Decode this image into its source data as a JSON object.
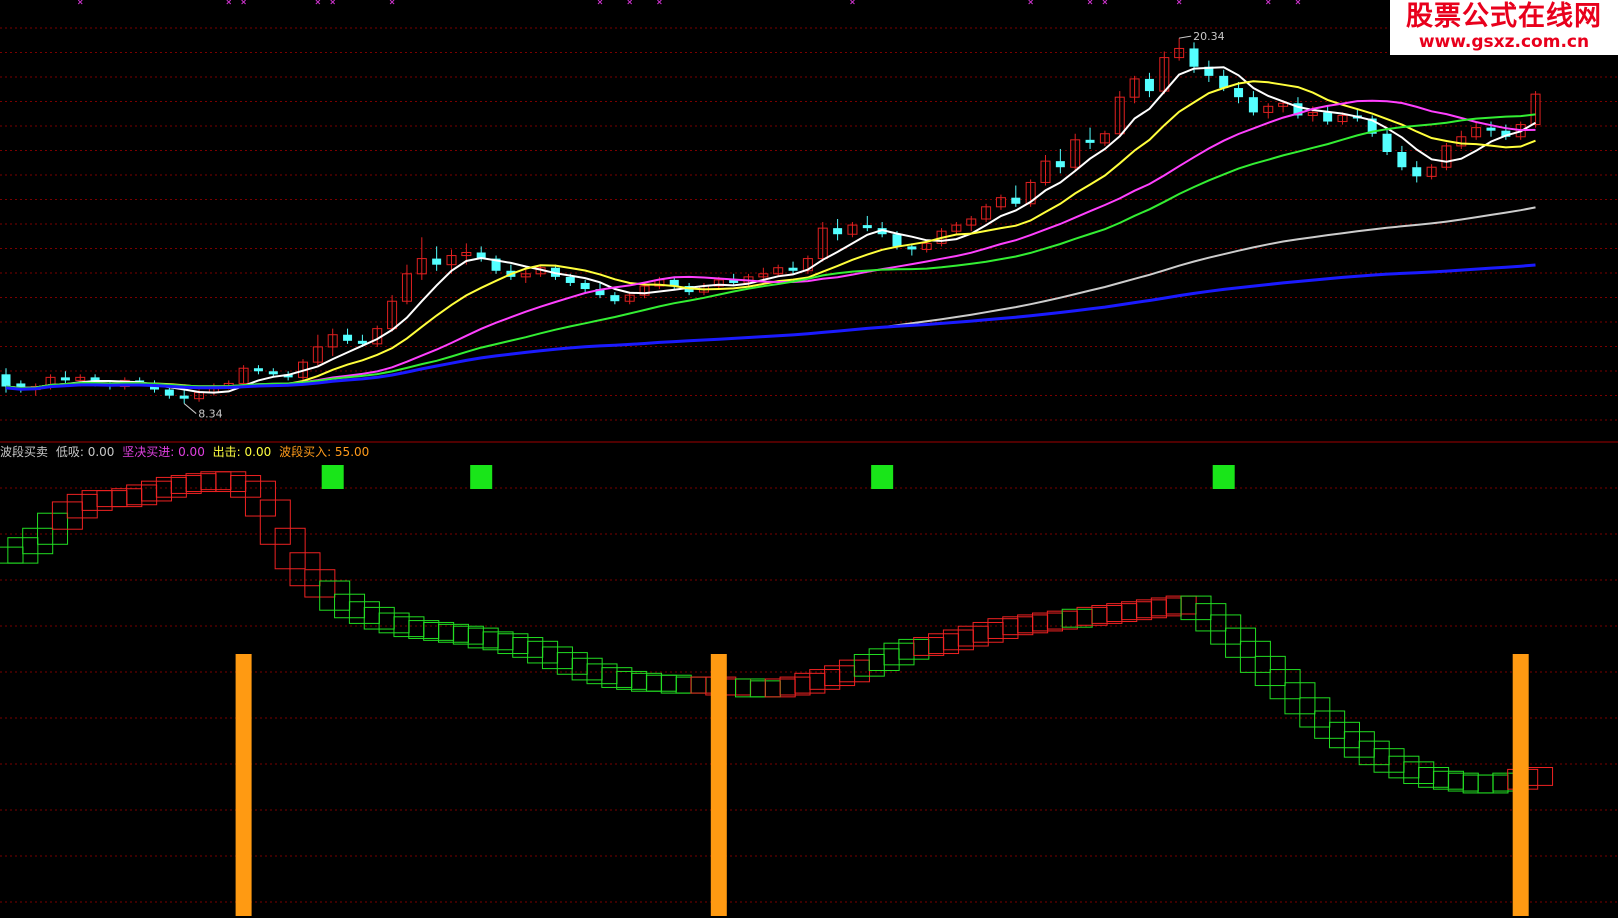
{
  "watermark": {
    "site_name": "股票公式在线网",
    "url": "www.gsxz.com.cn"
  },
  "colors": {
    "background": "#000000",
    "grid": "#7a0000",
    "candle_up": "#e02020",
    "candle_down": "#54ffff",
    "ma1": "#ffffff",
    "ma2": "#ffff3c",
    "ma3": "#ff40ff",
    "ma4": "#33ee33",
    "ma5": "#cccccc",
    "ma6": "#1a1aff",
    "marker": "#cc33cc"
  },
  "indicator_legend": [
    {
      "text": "波段买卖",
      "color": "#c8c8c8"
    },
    {
      "text": "低吸: 0.00",
      "color": "#c8c8c8"
    },
    {
      "text": "坚决买进: 0.00",
      "color": "#e040e0"
    },
    {
      "text": "出击: 0.00",
      "color": "#ffff40"
    },
    {
      "text": "波段买入: 55.00",
      "color": "#ff9a1a"
    }
  ],
  "chart_data": [
    {
      "type": "candlestick",
      "grid": true,
      "price_labels": [
        {
          "text": "20.34",
          "bar": 79,
          "value": 20.34
        },
        {
          "text": "8.34",
          "bar": 12,
          "value": 8.34
        }
      ],
      "candles": [
        [
          9.3,
          9.5,
          8.7,
          8.9
        ],
        [
          9.0,
          9.1,
          8.7,
          8.8
        ],
        [
          8.8,
          9.0,
          8.6,
          8.9
        ],
        [
          8.9,
          9.3,
          8.8,
          9.2
        ],
        [
          9.2,
          9.4,
          9.0,
          9.1
        ],
        [
          9.1,
          9.3,
          8.9,
          9.2
        ],
        [
          9.2,
          9.3,
          8.9,
          9.0
        ],
        [
          9.0,
          9.1,
          8.8,
          8.9
        ],
        [
          8.9,
          9.2,
          8.8,
          9.1
        ],
        [
          9.1,
          9.2,
          8.9,
          9.0
        ],
        [
          9.0,
          9.1,
          8.7,
          8.8
        ],
        [
          8.8,
          8.9,
          8.5,
          8.6
        ],
        [
          8.6,
          8.8,
          8.34,
          8.5
        ],
        [
          8.5,
          8.8,
          8.4,
          8.7
        ],
        [
          8.7,
          9.0,
          8.6,
          8.9
        ],
        [
          8.9,
          9.1,
          8.8,
          9.0
        ],
        [
          9.0,
          9.6,
          8.9,
          9.5
        ],
        [
          9.5,
          9.6,
          9.3,
          9.4
        ],
        [
          9.4,
          9.5,
          9.2,
          9.3
        ],
        [
          9.3,
          9.4,
          9.1,
          9.2
        ],
        [
          9.2,
          9.8,
          9.1,
          9.7
        ],
        [
          9.7,
          10.6,
          9.6,
          10.2
        ],
        [
          10.2,
          10.8,
          9.9,
          10.6
        ],
        [
          10.6,
          10.8,
          10.3,
          10.4
        ],
        [
          10.4,
          10.6,
          10.2,
          10.3
        ],
        [
          10.3,
          10.9,
          10.2,
          10.8
        ],
        [
          10.8,
          11.9,
          10.7,
          11.7
        ],
        [
          11.7,
          12.9,
          11.6,
          12.6
        ],
        [
          12.6,
          13.8,
          12.4,
          13.1
        ],
        [
          13.1,
          13.5,
          12.7,
          12.9
        ],
        [
          12.9,
          13.4,
          12.6,
          13.2
        ],
        [
          13.2,
          13.6,
          12.9,
          13.3
        ],
        [
          13.3,
          13.5,
          13.0,
          13.1
        ],
        [
          13.1,
          13.2,
          12.6,
          12.7
        ],
        [
          12.7,
          12.9,
          12.4,
          12.5
        ],
        [
          12.5,
          12.8,
          12.3,
          12.6
        ],
        [
          12.6,
          12.9,
          12.5,
          12.8
        ],
        [
          12.8,
          12.9,
          12.4,
          12.5
        ],
        [
          12.5,
          12.6,
          12.2,
          12.3
        ],
        [
          12.3,
          12.4,
          12.0,
          12.1
        ],
        [
          12.1,
          12.3,
          11.8,
          11.9
        ],
        [
          11.9,
          12.0,
          11.6,
          11.7
        ],
        [
          11.7,
          12.0,
          11.6,
          11.9
        ],
        [
          11.9,
          12.3,
          11.8,
          12.2
        ],
        [
          12.2,
          12.5,
          12.1,
          12.4
        ],
        [
          12.4,
          12.5,
          12.1,
          12.2
        ],
        [
          12.2,
          12.3,
          11.9,
          12.0
        ],
        [
          12.0,
          12.3,
          11.9,
          12.2
        ],
        [
          12.2,
          12.5,
          12.1,
          12.4
        ],
        [
          12.4,
          12.6,
          12.2,
          12.3
        ],
        [
          12.3,
          12.6,
          12.2,
          12.5
        ],
        [
          12.5,
          12.8,
          12.4,
          12.6
        ],
        [
          12.6,
          12.9,
          12.5,
          12.8
        ],
        [
          12.8,
          13.0,
          12.6,
          12.7
        ],
        [
          12.7,
          13.2,
          12.6,
          13.1
        ],
        [
          13.1,
          14.3,
          13.0,
          14.1
        ],
        [
          14.1,
          14.4,
          13.7,
          13.9
        ],
        [
          13.9,
          14.3,
          13.8,
          14.2
        ],
        [
          14.2,
          14.5,
          14.0,
          14.1
        ],
        [
          14.1,
          14.3,
          13.8,
          13.9
        ],
        [
          13.9,
          14.0,
          13.4,
          13.5
        ],
        [
          13.5,
          13.6,
          13.2,
          13.4
        ],
        [
          13.4,
          13.7,
          13.3,
          13.6
        ],
        [
          13.6,
          14.1,
          13.5,
          14.0
        ],
        [
          14.0,
          14.3,
          13.9,
          14.2
        ],
        [
          14.2,
          14.5,
          14.0,
          14.4
        ],
        [
          14.4,
          14.9,
          14.3,
          14.8
        ],
        [
          14.8,
          15.2,
          14.7,
          15.1
        ],
        [
          15.1,
          15.5,
          14.8,
          14.9
        ],
        [
          14.9,
          15.7,
          14.8,
          15.6
        ],
        [
          15.6,
          16.5,
          15.5,
          16.3
        ],
        [
          16.3,
          16.7,
          15.9,
          16.1
        ],
        [
          16.1,
          17.2,
          16.0,
          17.0
        ],
        [
          17.0,
          17.4,
          16.7,
          16.9
        ],
        [
          16.9,
          17.3,
          16.8,
          17.2
        ],
        [
          17.2,
          18.6,
          17.1,
          18.4
        ],
        [
          18.4,
          19.1,
          18.2,
          19.0
        ],
        [
          19.0,
          19.2,
          18.4,
          18.6
        ],
        [
          18.6,
          19.9,
          18.5,
          19.7
        ],
        [
          19.7,
          20.34,
          19.6,
          20.0
        ],
        [
          20.0,
          20.2,
          19.2,
          19.4
        ],
        [
          19.4,
          19.6,
          18.9,
          19.1
        ],
        [
          19.1,
          19.3,
          18.6,
          18.7
        ],
        [
          18.7,
          18.9,
          18.2,
          18.4
        ],
        [
          18.4,
          18.6,
          17.8,
          17.9
        ],
        [
          17.9,
          18.2,
          17.7,
          18.1
        ],
        [
          18.1,
          18.3,
          17.9,
          18.2
        ],
        [
          18.2,
          18.4,
          17.7,
          17.8
        ],
        [
          17.8,
          18.1,
          17.6,
          17.9
        ],
        [
          17.9,
          18.1,
          17.5,
          17.6
        ],
        [
          17.6,
          17.9,
          17.5,
          17.8
        ],
        [
          17.8,
          18.0,
          17.6,
          17.7
        ],
        [
          17.7,
          17.8,
          17.1,
          17.2
        ],
        [
          17.2,
          17.4,
          16.5,
          16.6
        ],
        [
          16.6,
          16.8,
          16.0,
          16.1
        ],
        [
          16.1,
          16.3,
          15.6,
          15.8
        ],
        [
          15.8,
          16.2,
          15.7,
          16.1
        ],
        [
          16.1,
          16.9,
          16.0,
          16.8
        ],
        [
          16.8,
          17.3,
          16.7,
          17.1
        ],
        [
          17.1,
          17.6,
          17.0,
          17.4
        ],
        [
          17.4,
          17.6,
          17.1,
          17.3
        ],
        [
          17.3,
          17.5,
          17.0,
          17.1
        ],
        [
          17.1,
          17.6,
          17.0,
          17.5
        ],
        [
          17.5,
          18.6,
          17.4,
          18.5
        ]
      ],
      "ma_series": [
        {
          "key": "ma1",
          "period": 5
        },
        {
          "key": "ma2",
          "period": 10
        },
        {
          "key": "ma3",
          "period": 20
        },
        {
          "key": "ma4",
          "period": 30
        },
        {
          "key": "ma5",
          "period": 60
        },
        {
          "key": "ma6",
          "period": 120
        }
      ]
    },
    {
      "type": "indicator",
      "grid": true,
      "wave_line": [
        20,
        25,
        30,
        38,
        44,
        48,
        50,
        50,
        51,
        53,
        55,
        57,
        58,
        59,
        60,
        58,
        55,
        45,
        30,
        17,
        8,
        2,
        -5,
        -9,
        -12,
        -15,
        -17,
        -19,
        -20,
        -21,
        -22,
        -23,
        -25,
        -26,
        -28,
        -30,
        -33,
        -36,
        -39,
        -42,
        -44,
        -46,
        -47,
        -48,
        -48,
        -49,
        -49,
        -49,
        -50,
        -50,
        -51,
        -51,
        -50,
        -49,
        -47,
        -45,
        -43,
        -40,
        -37,
        -34,
        -31,
        -29,
        -28,
        -26,
        -24,
        -22,
        -20,
        -18,
        -17,
        -16,
        -15,
        -14,
        -13,
        -12,
        -11,
        -10,
        -9,
        -8,
        -7,
        -6,
        -10,
        -16,
        -23,
        -30,
        -38,
        -45,
        -52,
        -60,
        -67,
        -73,
        -78,
        -83,
        -87,
        -91,
        -94,
        -97,
        -99,
        -100,
        -101,
        -102,
        -101,
        -100,
        -98,
        -97
      ],
      "trend_flags": [
        0,
        0,
        0,
        0,
        1,
        1,
        1,
        1,
        1,
        1,
        1,
        1,
        1,
        1,
        1,
        1,
        1,
        1,
        1,
        1,
        1,
        1,
        0,
        0,
        0,
        0,
        0,
        0,
        0,
        0,
        0,
        0,
        0,
        0,
        0,
        0,
        0,
        0,
        0,
        0,
        0,
        0,
        0,
        0,
        0,
        0,
        0,
        1,
        1,
        1,
        0,
        0,
        1,
        1,
        1,
        1,
        1,
        1,
        0,
        0,
        0,
        0,
        1,
        1,
        1,
        1,
        1,
        1,
        1,
        1,
        1,
        1,
        0,
        1,
        1,
        1,
        1,
        1,
        1,
        1,
        0,
        0,
        0,
        0,
        0,
        0,
        0,
        0,
        0,
        0,
        0,
        0,
        0,
        0,
        0,
        0,
        0,
        0,
        0,
        0,
        0,
        0,
        1,
        1
      ],
      "buy_bars": [
        16,
        48,
        102
      ],
      "sell_signals": [
        22,
        32,
        59,
        82
      ]
    }
  ]
}
